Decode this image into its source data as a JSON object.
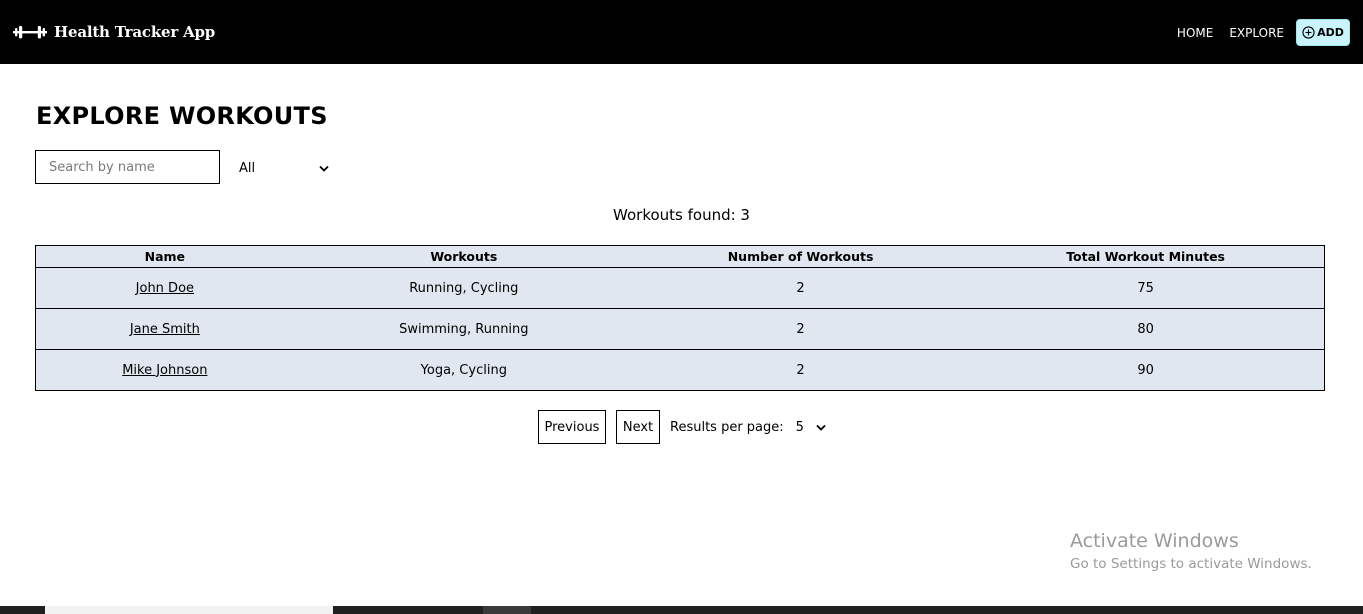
{
  "header": {
    "app_title": "Health Tracker App",
    "logo_icon": "dumbbell-icon",
    "nav": {
      "home": "HOME",
      "explore": "EXPLORE",
      "add_label": "ADD",
      "add_icon": "plus-circle-icon"
    }
  },
  "main": {
    "title": "EXPLORE WORKOUTS",
    "search": {
      "placeholder": "Search by name",
      "value": ""
    },
    "filter": {
      "selected": "All"
    },
    "found_text": "Workouts found: 3"
  },
  "table": {
    "headers": [
      "Name",
      "Workouts",
      "Number of Workouts",
      "Total Workout Minutes"
    ],
    "rows": [
      {
        "name": "John Doe",
        "workouts": "Running, Cycling",
        "count": "2",
        "minutes": "75"
      },
      {
        "name": "Jane Smith",
        "workouts": "Swimming, Running",
        "count": "2",
        "minutes": "80"
      },
      {
        "name": "Mike Johnson",
        "workouts": "Yoga, Cycling",
        "count": "2",
        "minutes": "90"
      }
    ]
  },
  "pagination": {
    "previous": "Previous",
    "next": "Next",
    "results_label": "Results per page:",
    "results_value": "5"
  },
  "watermark": {
    "title": "Activate Windows",
    "subtitle": "Go to Settings to activate Windows."
  },
  "colors": {
    "header_bg": "#000000",
    "add_button_bg": "#c9f4fb",
    "table_bg": "#e1e7f0"
  }
}
